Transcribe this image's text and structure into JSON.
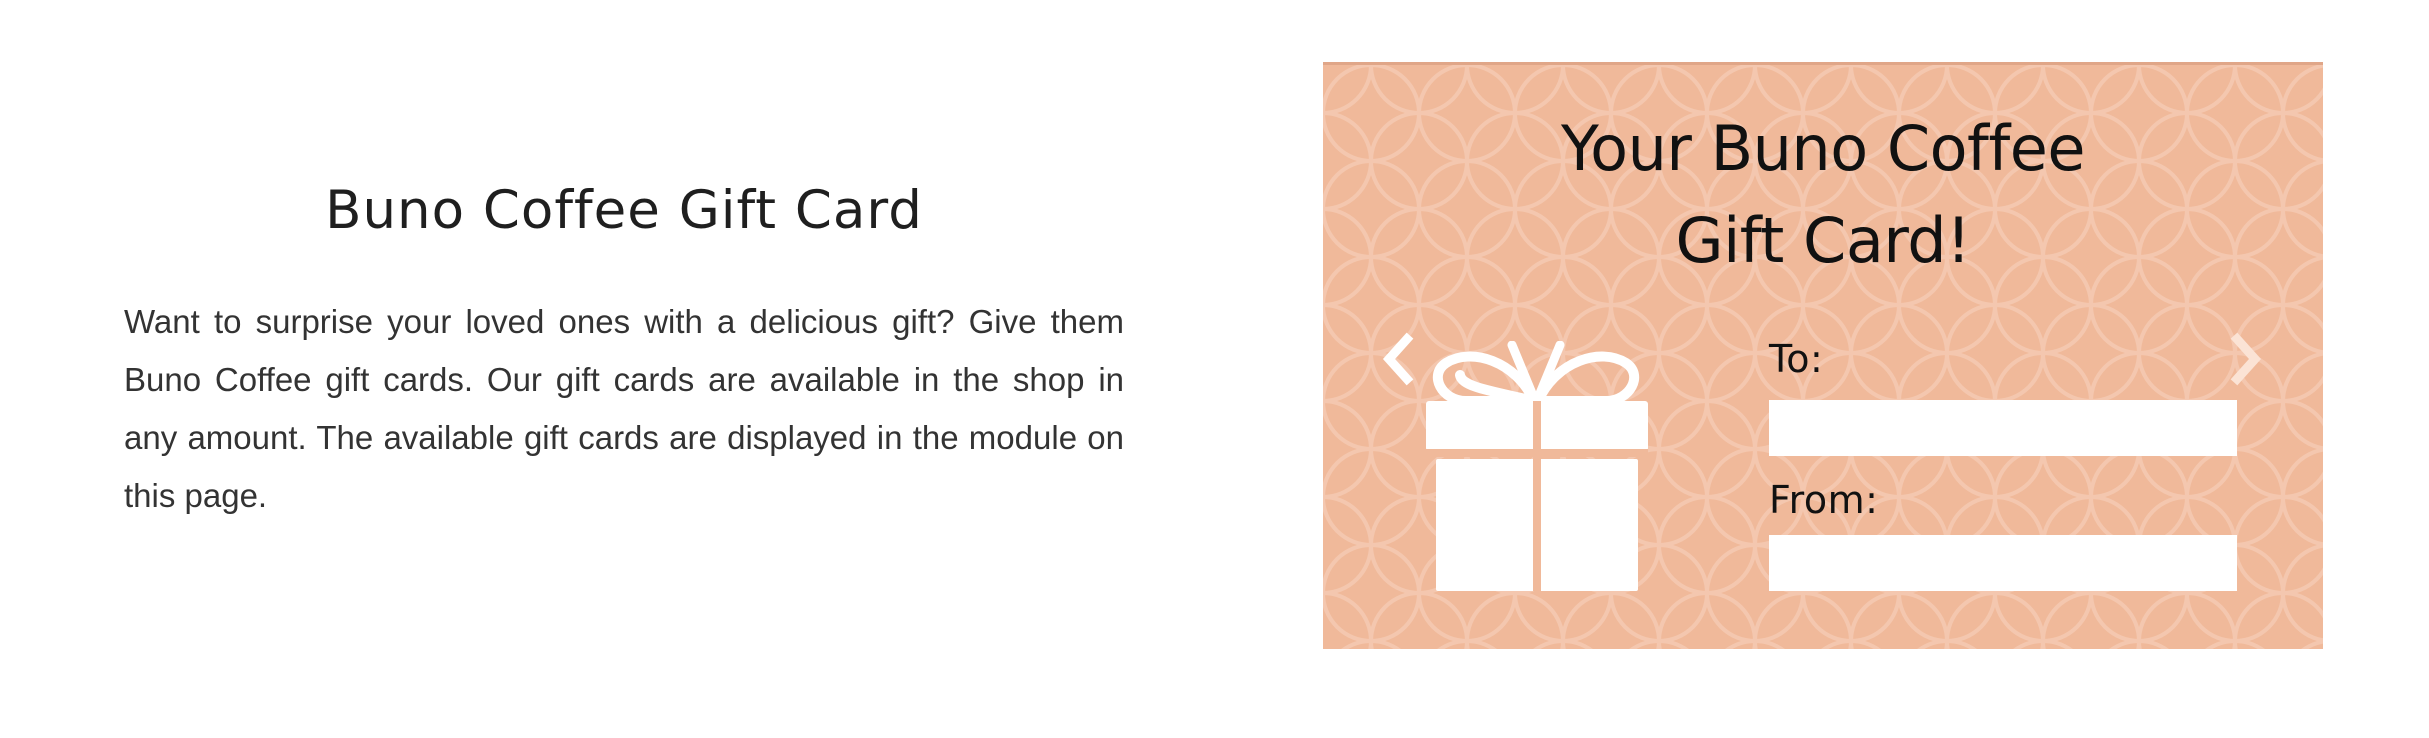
{
  "intro": {
    "heading": "Buno Coffee Gift Card",
    "body": "Want to surprise your loved ones with a delicious gift? Give them Buno Coffee gift cards. Our gift cards are available in the shop in any amount. The available gift cards are displayed in the module on this page."
  },
  "gift_card": {
    "title_line1": "Your Buno Coffee",
    "title_line2": "Gift Card!",
    "to_label": "To:",
    "from_label": "From:",
    "to_value": "",
    "from_value": "",
    "background_color": "#f0b99a",
    "illustration_icon": "gift-box-icon",
    "prev_icon": "chevron-left-icon",
    "next_icon": "chevron-right-icon"
  }
}
